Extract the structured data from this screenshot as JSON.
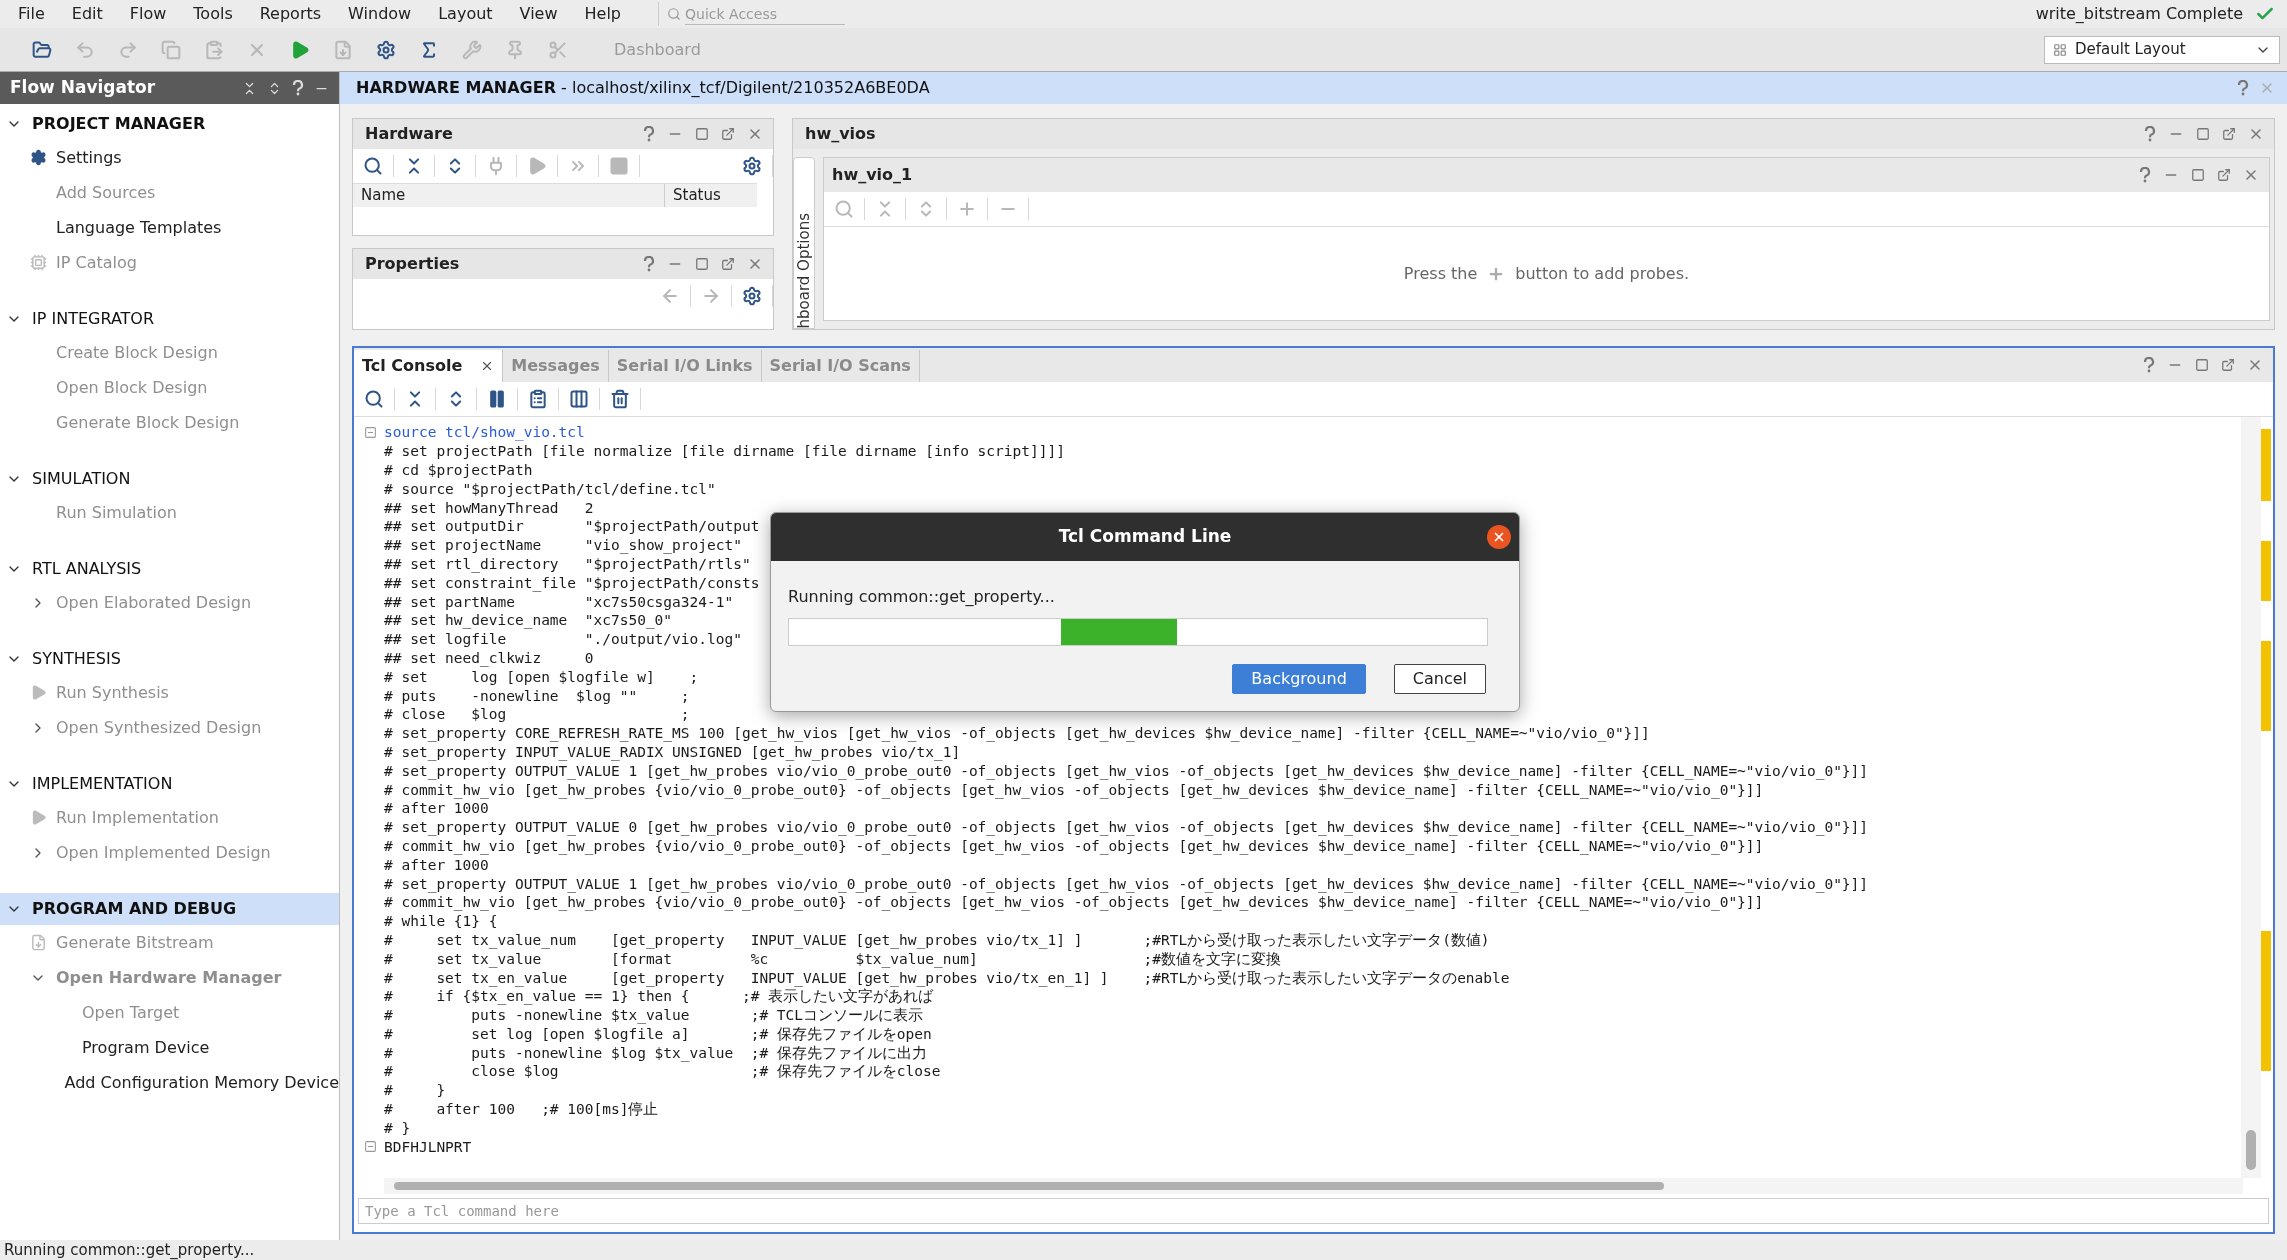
{
  "menu_bar": {
    "items": [
      "File",
      "Edit",
      "Flow",
      "Tools",
      "Reports",
      "Window",
      "Layout",
      "View",
      "Help"
    ],
    "quick_access": {
      "placeholder": "Quick Access"
    },
    "status": "write_bitstream Complete"
  },
  "toolbar": {
    "buttons": [
      {
        "kind": "open",
        "disabled": false
      },
      {
        "kind": "undo",
        "disabled": true
      },
      {
        "kind": "redo",
        "disabled": true
      },
      {
        "kind": "copy",
        "disabled": true
      },
      {
        "kind": "paste",
        "disabled": true
      },
      {
        "kind": "delete",
        "disabled": true
      },
      {
        "kind": "run",
        "disabled": false
      },
      {
        "kind": "bitstream",
        "disabled": true
      },
      {
        "kind": "settings",
        "disabled": false
      },
      {
        "kind": "sigma",
        "disabled": false
      },
      {
        "kind": "tool",
        "disabled": true
      },
      {
        "kind": "pin",
        "disabled": true
      },
      {
        "kind": "cut",
        "disabled": true
      }
    ],
    "dashboard": {
      "label": "Dashboard",
      "disabled": true
    },
    "layout": {
      "value": "Default Layout"
    }
  },
  "nav": {
    "title": "Flow Navigator",
    "sections": [
      {
        "label": "PROJECT MANAGER",
        "expanded": true,
        "selected": false,
        "active": true,
        "items": [
          {
            "label": "Settings",
            "disabled": false,
            "kind": "gear"
          },
          {
            "label": "Add Sources",
            "disabled": true
          },
          {
            "label": "Language Templates",
            "disabled": false
          },
          {
            "label": "IP Catalog",
            "disabled": true,
            "kind": "chip"
          }
        ]
      },
      {
        "label": "IP INTEGRATOR",
        "expanded": true,
        "selected": false,
        "active": false,
        "items": [
          {
            "label": "Create Block Design",
            "disabled": true
          },
          {
            "label": "Open Block Design",
            "disabled": true
          },
          {
            "label": "Generate Block Design",
            "disabled": true
          }
        ]
      },
      {
        "label": "SIMULATION",
        "expanded": true,
        "selected": false,
        "active": false,
        "items": [
          {
            "label": "Run Simulation",
            "disabled": true
          }
        ]
      },
      {
        "label": "RTL ANALYSIS",
        "expanded": true,
        "selected": false,
        "active": false,
        "items": [
          {
            "label": "Open Elaborated Design",
            "disabled": true,
            "expanded": false
          }
        ]
      },
      {
        "label": "SYNTHESIS",
        "expanded": true,
        "selected": false,
        "active": false,
        "items": [
          {
            "label": "Run Synthesis",
            "disabled": true,
            "kind": "run"
          },
          {
            "label": "Open Synthesized Design",
            "disabled": true,
            "expanded": false
          }
        ]
      },
      {
        "label": "IMPLEMENTATION",
        "expanded": true,
        "selected": false,
        "active": false,
        "items": [
          {
            "label": "Run Implementation",
            "disabled": true,
            "kind": "run"
          },
          {
            "label": "Open Implemented Design",
            "disabled": true,
            "expanded": false
          }
        ]
      },
      {
        "label": "PROGRAM AND DEBUG",
        "expanded": true,
        "selected": true,
        "active": true,
        "items": [
          {
            "label": "Generate Bitstream",
            "disabled": true,
            "kind": "bitstream"
          },
          {
            "label": "Open Hardware Manager",
            "disabled": true,
            "emphasized": true,
            "expanded": true,
            "children": [
              {
                "label": "Open Target",
                "disabled": true
              },
              {
                "label": "Program Device",
                "disabled": false
              },
              {
                "label": "Add Configuration Memory Device",
                "disabled": false
              }
            ]
          }
        ]
      }
    ]
  },
  "main_header": {
    "title": "HARDWARE MANAGER",
    "separator": "-",
    "path": "localhost/xilinx_tcf/Digilent/210352A6BE0DA"
  },
  "hardware": {
    "title": "Hardware",
    "toolbar": {
      "left": [
        {
          "kind": "search",
          "disabled": false
        },
        {
          "kind": "collapse",
          "disabled": false
        },
        {
          "kind": "expand",
          "disabled": false
        },
        {
          "kind": "connect",
          "disabled": true
        },
        {
          "kind": "play",
          "disabled": true
        },
        {
          "kind": "forward",
          "disabled": true
        },
        {
          "kind": "stop",
          "disabled": true
        }
      ],
      "right": [
        {
          "kind": "gear",
          "disabled": false
        }
      ]
    },
    "columns": [
      "Name",
      "Status"
    ]
  },
  "properties": {
    "title": "Properties",
    "toolbar": {
      "right": [
        {
          "kind": "back",
          "disabled": true
        },
        {
          "kind": "next",
          "disabled": true
        },
        {
          "kind": "gear",
          "disabled": false
        }
      ]
    }
  },
  "hw_vios": {
    "title": "hw_vios",
    "side_tab": "hboard Options",
    "vio": {
      "title": "hw_vio_1",
      "toolbar": {
        "left": [
          {
            "kind": "search",
            "disabled": true
          },
          {
            "kind": "collapse",
            "disabled": true
          },
          {
            "kind": "expand",
            "disabled": true
          },
          {
            "kind": "plus",
            "disabled": true
          },
          {
            "kind": "minus",
            "disabled": true
          }
        ]
      },
      "hint_before": "Press the",
      "hint_after": "button to add probes."
    }
  },
  "console": {
    "tabs": [
      {
        "label": "Tcl Console",
        "selected": true,
        "closable": true
      },
      {
        "label": "Messages",
        "selected": false,
        "closable": false
      },
      {
        "label": "Serial I/O Links",
        "selected": false,
        "closable": false
      },
      {
        "label": "Serial I/O Scans",
        "selected": false,
        "closable": false
      }
    ],
    "toolbar": {
      "left": [
        {
          "kind": "search",
          "disabled": false
        },
        {
          "kind": "collapse",
          "disabled": false
        },
        {
          "kind": "expand",
          "disabled": false
        },
        {
          "kind": "pause",
          "disabled": false
        },
        {
          "kind": "clipboard",
          "disabled": false
        },
        {
          "kind": "columns",
          "disabled": false
        },
        {
          "kind": "trash",
          "disabled": false
        }
      ]
    },
    "lines": [
      {
        "text": "source tcl/show_vio.tcl",
        "kind": "command",
        "fold": true
      },
      {
        "text": "# set projectPath [file normalize [file dirname [file dirname [info script]]]]",
        "kind": "output",
        "fold": false
      },
      {
        "text": "# cd $projectPath",
        "kind": "output",
        "fold": false
      },
      {
        "text": "# source \"$projectPath/tcl/define.tcl\"",
        "kind": "output",
        "fold": false
      },
      {
        "text": "## set howManyThread   2",
        "kind": "output",
        "fold": false
      },
      {
        "text": "## set outputDir       \"$projectPath/output",
        "kind": "output",
        "fold": false
      },
      {
        "text": "## set projectName     \"vio_show_project\"",
        "kind": "output",
        "fold": false
      },
      {
        "text": "## set rtl_directory   \"$projectPath/rtls\"",
        "kind": "output",
        "fold": false
      },
      {
        "text": "## set constraint_file \"$projectPath/consts",
        "kind": "output",
        "fold": false
      },
      {
        "text": "## set partName        \"xc7s50csga324-1\"",
        "kind": "output",
        "fold": false
      },
      {
        "text": "## set hw_device_name  \"xc7s50_0\"",
        "kind": "output",
        "fold": false
      },
      {
        "text": "## set logfile         \"./output/vio.log\"",
        "kind": "output",
        "fold": false
      },
      {
        "text": "## set need_clkwiz     0",
        "kind": "output",
        "fold": false
      },
      {
        "text": "# set     log [open $logfile w]    ;",
        "kind": "output",
        "fold": false
      },
      {
        "text": "# puts    -nonewline  $log \"\"     ;",
        "kind": "output",
        "fold": false
      },
      {
        "text": "# close   $log                    ;",
        "kind": "output",
        "fold": false
      },
      {
        "text": "# set_property CORE_REFRESH_RATE_MS 100 [get_hw_vios [get_hw_vios -of_objects [get_hw_devices $hw_device_name] -filter {CELL_NAME=~\"vio/vio_0\"}]]",
        "kind": "output",
        "fold": false
      },
      {
        "text": "# set_property INPUT_VALUE_RADIX UNSIGNED [get_hw_probes vio/tx_1]",
        "kind": "output",
        "fold": false
      },
      {
        "text": "# set_property OUTPUT_VALUE 1 [get_hw_probes vio/vio_0_probe_out0 -of_objects [get_hw_vios -of_objects [get_hw_devices $hw_device_name] -filter {CELL_NAME=~\"vio/vio_0\"}]]",
        "kind": "output",
        "fold": false
      },
      {
        "text": "# commit_hw_vio [get_hw_probes {vio/vio_0_probe_out0} -of_objects [get_hw_vios -of_objects [get_hw_devices $hw_device_name] -filter {CELL_NAME=~\"vio/vio_0\"}]]",
        "kind": "output",
        "fold": false
      },
      {
        "text": "# after 1000",
        "kind": "output",
        "fold": false
      },
      {
        "text": "# set_property OUTPUT_VALUE 0 [get_hw_probes vio/vio_0_probe_out0 -of_objects [get_hw_vios -of_objects [get_hw_devices $hw_device_name] -filter {CELL_NAME=~\"vio/vio_0\"}]]",
        "kind": "output",
        "fold": false
      },
      {
        "text": "# commit_hw_vio [get_hw_probes {vio/vio_0_probe_out0} -of_objects [get_hw_vios -of_objects [get_hw_devices $hw_device_name] -filter {CELL_NAME=~\"vio/vio_0\"}]]",
        "kind": "output",
        "fold": false
      },
      {
        "text": "# after 1000",
        "kind": "output",
        "fold": false
      },
      {
        "text": "# set_property OUTPUT_VALUE 1 [get_hw_probes vio/vio_0_probe_out0 -of_objects [get_hw_vios -of_objects [get_hw_devices $hw_device_name] -filter {CELL_NAME=~\"vio/vio_0\"}]]",
        "kind": "output",
        "fold": false
      },
      {
        "text": "# commit_hw_vio [get_hw_probes {vio/vio_0_probe_out0} -of_objects [get_hw_vios -of_objects [get_hw_devices $hw_device_name] -filter {CELL_NAME=~\"vio/vio_0\"}]]",
        "kind": "output",
        "fold": false
      },
      {
        "text": "# while {1} {",
        "kind": "output",
        "fold": false
      },
      {
        "text": "#     set tx_value_num    [get_property   INPUT_VALUE [get_hw_probes vio/tx_1] ]       ;#RTLから受け取った表示したい文字データ(数値)",
        "kind": "output",
        "fold": false
      },
      {
        "text": "#     set tx_value        [format         %c          $tx_value_num]                   ;#数値を文字に変換",
        "kind": "output",
        "fold": false
      },
      {
        "text": "#     set tx_en_value     [get_property   INPUT_VALUE [get_hw_probes vio/tx_en_1] ]    ;#RTLから受け取った表示したい文字データのenable",
        "kind": "output",
        "fold": false
      },
      {
        "text": "#     if {$tx_en_value == 1} then {      ;# 表示したい文字があれば",
        "kind": "output",
        "fold": false
      },
      {
        "text": "#         puts -nonewline $tx_value       ;# TCLコンソールに表示",
        "kind": "output",
        "fold": false
      },
      {
        "text": "#         set log [open $logfile a]       ;# 保存先ファイルをopen",
        "kind": "output",
        "fold": false
      },
      {
        "text": "#         puts -nonewline $log $tx_value  ;# 保存先ファイルに出力",
        "kind": "output",
        "fold": false
      },
      {
        "text": "#         close $log                      ;# 保存先ファイルをclose",
        "kind": "output",
        "fold": false
      },
      {
        "text": "#     }",
        "kind": "output",
        "fold": false
      },
      {
        "text": "#     after 100   ;# 100[ms]停止",
        "kind": "output",
        "fold": false
      },
      {
        "text": "# }",
        "kind": "output",
        "fold": false
      },
      {
        "text": "BDFHJLNPRT",
        "kind": "output",
        "fold": true
      }
    ],
    "input": {
      "placeholder": "Type a Tcl command here"
    }
  },
  "dialog": {
    "title": "Tcl Command Line",
    "message": "Running common::get_property...",
    "progress": {
      "indeterminate": true
    },
    "buttons": [
      {
        "label": "Background",
        "kind": "primary"
      },
      {
        "label": "Cancel",
        "kind": "secondary"
      }
    ]
  },
  "status_bar": {
    "text": "Running common::get_property..."
  }
}
